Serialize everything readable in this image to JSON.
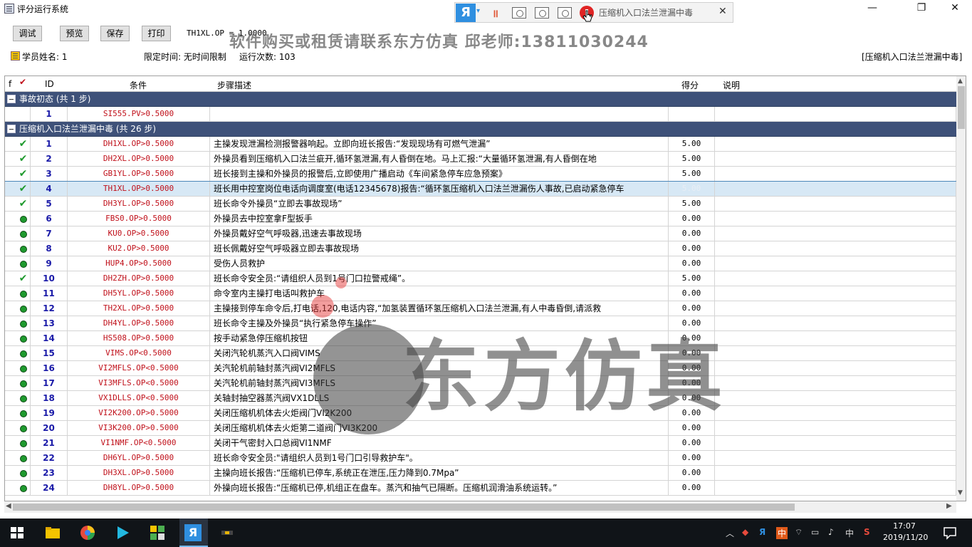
{
  "window": {
    "title": "评分运行系统",
    "minimize": "—",
    "maximize": "❐",
    "close": "✕"
  },
  "recorder": {
    "logo": "Я",
    "arrow": "▾",
    "pause": "॥",
    "input": "压缩机入口法兰泄漏中毒",
    "close": "✕"
  },
  "toolbar": {
    "debug": "调试",
    "preview": "预览",
    "save": "保存",
    "print": "打印",
    "formula": "TH1XL.OP = 1.0000"
  },
  "banner": "软件购买或租赁请联系东方仿真 邱老师:13811030244",
  "info": {
    "student": "学员姓名: 1",
    "limit": "限定时间: 无时间限制",
    "runs": "运行次数: 103",
    "scenario": "[压缩机入口法兰泄漏中毒]"
  },
  "grid_headers": {
    "f": "f",
    "id": "ID",
    "cond": "条件",
    "step": "步骤描述",
    "score": "得分",
    "note": "说明"
  },
  "groups": [
    {
      "label": "事故初态 (共 1 步)"
    },
    {
      "label": "压缩机入口法兰泄漏中毒 (共 26 步)"
    }
  ],
  "rows": [
    {
      "id": "1",
      "cond": "SI555.PV>0.5000",
      "step": "",
      "score": "",
      "mark": "none"
    },
    {
      "id": "1",
      "cond": "DH1XL.OP>0.5000",
      "step": "主操发现泄漏检测报警器响起。立即向班长报告:“发现现场有可燃气泄漏”",
      "score": "5.00",
      "mark": "tick"
    },
    {
      "id": "2",
      "cond": "DH2XL.OP>0.5000",
      "step": "外操员看到压缩机入口法兰疵开,循环氢泄漏,有人昏倒在地。马上汇报:“大量循环氢泄漏,有人昏倒在地",
      "score": "5.00",
      "mark": "tick"
    },
    {
      "id": "3",
      "cond": "GB1YL.OP>0.5000",
      "step": "班长接到主操和外操员的报警后,立即使用广播启动《车间紧急停车应急预案》",
      "score": "5.00",
      "mark": "tick"
    },
    {
      "id": "4",
      "cond": "TH1XL.OP>0.5000",
      "step": "班长用中控室岗位电话向调度室(电话12345678)报告:“循环氢压缩机入口法兰泄漏伤人事故,已启动紧急停车",
      "score": "5.00",
      "mark": "tick",
      "selected": true
    },
    {
      "id": "5",
      "cond": "DH3YL.OP>0.5000",
      "step": "班长命令外操员“立即去事故现场”",
      "score": "5.00",
      "mark": "tick"
    },
    {
      "id": "6",
      "cond": "FBS0.OP>0.5000",
      "step": "外操员去中控室拿F型扳手",
      "score": "0.00",
      "mark": "dot"
    },
    {
      "id": "7",
      "cond": "KU0.OP>0.5000",
      "step": "外操员戴好空气呼吸器,迅速去事故现场",
      "score": "0.00",
      "mark": "dot"
    },
    {
      "id": "8",
      "cond": "KU2.OP>0.5000",
      "step": "班长佩戴好空气呼吸器立即去事故现场",
      "score": "0.00",
      "mark": "dot"
    },
    {
      "id": "9",
      "cond": "HUP4.OP>0.5000",
      "step": "受伤人员救护",
      "score": "0.00",
      "mark": "dot"
    },
    {
      "id": "10",
      "cond": "DH2ZH.OP>0.5000",
      "step": "班长命令安全员:“请组织人员到1号门口拉警戒绳”。",
      "score": "5.00",
      "mark": "tick"
    },
    {
      "id": "11",
      "cond": "DH5YL.OP>0.5000",
      "step": "命令室内主操打电话叫救护车",
      "score": "0.00",
      "mark": "dot"
    },
    {
      "id": "12",
      "cond": "TH2XL.OP>0.5000",
      "step": "主操接到停车命令后,打电话,120,电话内容,“加氢装置循环氢压缩机入口法兰泄漏,有人中毒昏倒,请派救",
      "score": "0.00",
      "mark": "dot"
    },
    {
      "id": "13",
      "cond": "DH4YL.OP>0.5000",
      "step": "班长命令主操及外操员“执行紧急停车操作”",
      "score": "0.00",
      "mark": "dot"
    },
    {
      "id": "14",
      "cond": "HS508.OP>0.5000",
      "step": "按手动紧急停压缩机按钮",
      "score": "0.00",
      "mark": "dot"
    },
    {
      "id": "15",
      "cond": "VIMS.OP<0.5000",
      "step": "关闭汽轮机蒸汽入口阀VIMS",
      "score": "0.00",
      "mark": "dot"
    },
    {
      "id": "16",
      "cond": "VI2MFLS.OP<0.5000",
      "step": "关汽轮机前轴封蒸汽阀VI2MFLS",
      "score": "0.00",
      "mark": "dot"
    },
    {
      "id": "17",
      "cond": "VI3MFLS.OP<0.5000",
      "step": "关汽轮机前轴封蒸汽阀VI3MFLS",
      "score": "0.00",
      "mark": "dot"
    },
    {
      "id": "18",
      "cond": "VX1DLLS.OP<0.5000",
      "step": "关轴封抽空器蒸汽阀VX1DLLS",
      "score": "0.00",
      "mark": "dot"
    },
    {
      "id": "19",
      "cond": "VI2K200.OP>0.5000",
      "step": "关闭压缩机机体去火炬阀门VI2K200",
      "score": "0.00",
      "mark": "dot"
    },
    {
      "id": "20",
      "cond": "VI3K200.OP>0.5000",
      "step": "关闭压缩机机体去火炬第二道阀门VI3K200",
      "score": "0.00",
      "mark": "dot"
    },
    {
      "id": "21",
      "cond": "VI1NMF.OP<0.5000",
      "step": "关闭干气密封入口总阀VI1NMF",
      "score": "0.00",
      "mark": "dot"
    },
    {
      "id": "22",
      "cond": "DH6YL.OP>0.5000",
      "step": "班长命令安全员:\"请组织人员到1号门口引导救护车\"。",
      "score": "0.00",
      "mark": "dot"
    },
    {
      "id": "23",
      "cond": "DH3XL.OP>0.5000",
      "step": "主操向班长报告:“压缩机已停车,系统正在泄压,压力降到0.7Mpa”",
      "score": "0.00",
      "mark": "dot"
    },
    {
      "id": "24",
      "cond": "DH8YL.OP>0.5000",
      "step": "外操向班长报告:“压缩机已停,机组正在盘车。蒸汽和抽气已隔断。压缩机润滑油系统运转。”",
      "score": "0.00",
      "mark": "dot"
    }
  ],
  "watermark": {
    "text": "东方仿真"
  },
  "taskbar": {
    "time": "17:07",
    "date": "2019/11/20",
    "ime": "中"
  },
  "colors": {
    "group_bg": "#3e5179",
    "id_color": "#1a1aa8",
    "cond_color": "#c0101a",
    "ok_green": "#1f9a2e",
    "selected_bg": "#d7e8f5"
  }
}
